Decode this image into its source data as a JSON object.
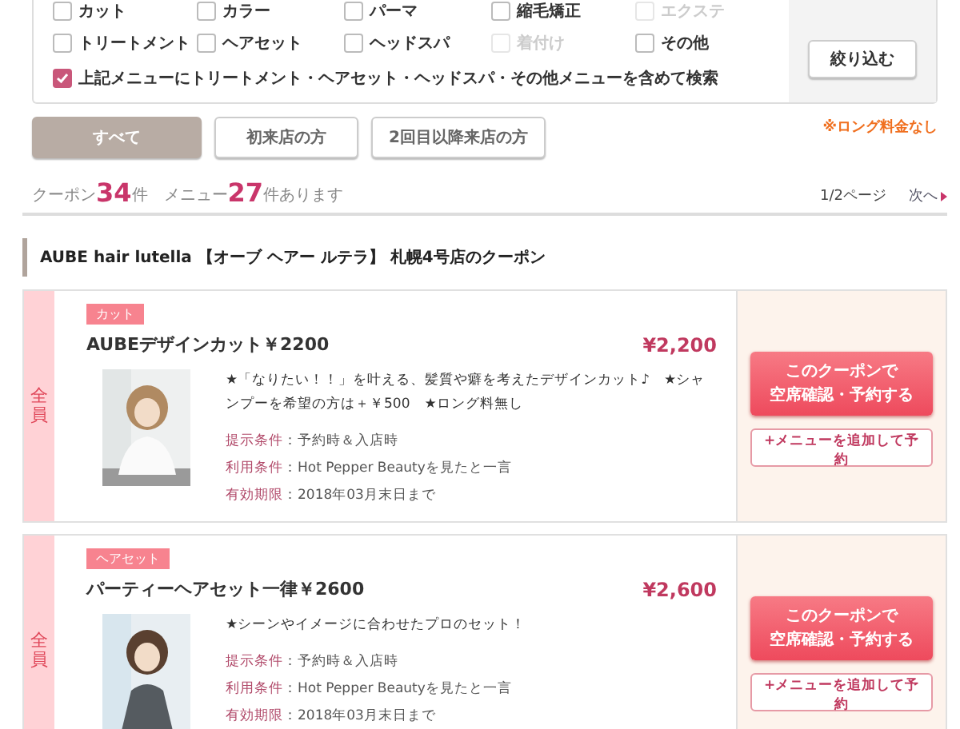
{
  "filter": {
    "options": [
      {
        "label": "カット",
        "checked": false,
        "disabled": false
      },
      {
        "label": "カラー",
        "checked": false,
        "disabled": false
      },
      {
        "label": "パーマ",
        "checked": false,
        "disabled": false
      },
      {
        "label": "縮毛矯正",
        "checked": false,
        "disabled": false
      },
      {
        "label": "エクステ",
        "checked": false,
        "disabled": true
      },
      {
        "label": "トリートメント",
        "checked": false,
        "disabled": false
      },
      {
        "label": "ヘアセット",
        "checked": false,
        "disabled": false
      },
      {
        "label": "ヘッドスパ",
        "checked": false,
        "disabled": false
      },
      {
        "label": "着付け",
        "checked": false,
        "disabled": true
      },
      {
        "label": "その他",
        "checked": false,
        "disabled": false
      }
    ],
    "include_option": {
      "label": "上記メニューにトリートメント・ヘアセット・ヘッドスパ・その他メニューを含めて検索",
      "checked": true
    },
    "button": "絞り込む"
  },
  "tabs": [
    {
      "label": "すべて",
      "selected": true
    },
    {
      "label": "初来店の方",
      "selected": false
    },
    {
      "label": "2回目以降来店の方",
      "selected": false
    }
  ],
  "note": "※ロング料金なし",
  "counts": {
    "coupon_label": "クーポン",
    "coupon_count": "34",
    "coupon_unit": "件",
    "menu_label": "メニュー",
    "menu_count": "27",
    "menu_suffix": "件あります"
  },
  "pagination": {
    "page": "1/2ページ",
    "next": "次へ"
  },
  "salon_heading": "AUBE hair lutella 【オーブ ヘアー ルテラ】 札幌4号店のクーポン",
  "coupons": [
    {
      "target": "全員",
      "tag": "カット",
      "title": "AUBEデザインカット￥2200",
      "price": "¥2,200",
      "description": "★「なりたい！！」を叶える、髪質や癖を考えたデザインカット♪　★シャンプーを希望の方は＋￥500　★ロング料無し",
      "conditions": [
        {
          "label": "提示条件",
          "value": "：予約時＆入店時"
        },
        {
          "label": "利用条件",
          "value": "：Hot Pepper Beautyを見たと一言"
        },
        {
          "label": "有効期限",
          "value": "：2018年03月末日まで"
        }
      ],
      "reserve_button": [
        "このクーポンで",
        "空席確認・予約する"
      ],
      "add_button": "+メニューを追加して予約"
    },
    {
      "target": "全員",
      "tag": "ヘアセット",
      "title": "パーティーヘアセット一律￥2600",
      "price": "¥2,600",
      "description": "★シーンやイメージに合わせたプロのセット！",
      "conditions": [
        {
          "label": "提示条件",
          "value": "：予約時＆入店時"
        },
        {
          "label": "利用条件",
          "value": "：Hot Pepper Beautyを見たと一言"
        },
        {
          "label": "有効期限",
          "value": "：2018年03月末日まで"
        }
      ],
      "reserve_button": [
        "このクーポンで",
        "空席確認・予約する"
      ],
      "add_button": "+メニューを追加して予約"
    }
  ]
}
